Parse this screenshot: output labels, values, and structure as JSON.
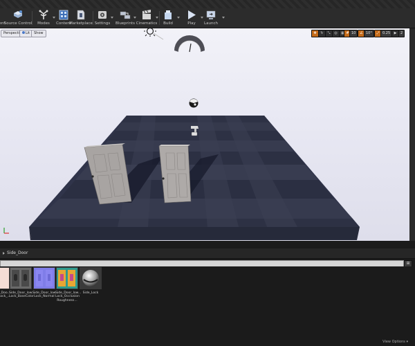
{
  "toolbar": {
    "items": [
      {
        "label": "ent",
        "icon": "partial-icon"
      },
      {
        "label": "Source Control",
        "icon": "source-control-icon"
      },
      {
        "label": "Modes",
        "icon": "modes-icon"
      },
      {
        "label": "Content",
        "icon": "content-icon"
      },
      {
        "label": "Marketplace",
        "icon": "marketplace-icon"
      },
      {
        "label": "Settings",
        "icon": "settings-icon"
      },
      {
        "label": "Blueprints",
        "icon": "blueprints-icon"
      },
      {
        "label": "Cinematics",
        "icon": "cinematics-icon"
      },
      {
        "label": "Build",
        "icon": "build-icon"
      },
      {
        "label": "Play",
        "icon": "play-icon"
      },
      {
        "label": "Launch",
        "icon": "launch-icon"
      }
    ]
  },
  "viewport": {
    "perspective_label": "Perspective",
    "lit_label": "Lit",
    "show_label": "Show",
    "snap": {
      "grid_value": "10",
      "rotation_value": "10°",
      "scale_value": "0.25",
      "camera_speed": "2"
    }
  },
  "content_browser": {
    "path": "Side_Door",
    "assets": [
      {
        "label": "Side_Doo...\nLock_..."
      },
      {
        "label": "Side_Door_low...\nLock_BaseColor"
      },
      {
        "label": "Side_Door_low...\nLock_Normal"
      },
      {
        "label": "Side_Door_low...\nLock_Occlusion\nRoughness..."
      },
      {
        "label": "Side_Lock"
      }
    ],
    "view_options": "View Options ▾"
  },
  "colors": {
    "accent_orange": "#c46b1a",
    "floor_tile_dark": "#2b2f40",
    "floor_tile_light": "#3a3e4f"
  }
}
